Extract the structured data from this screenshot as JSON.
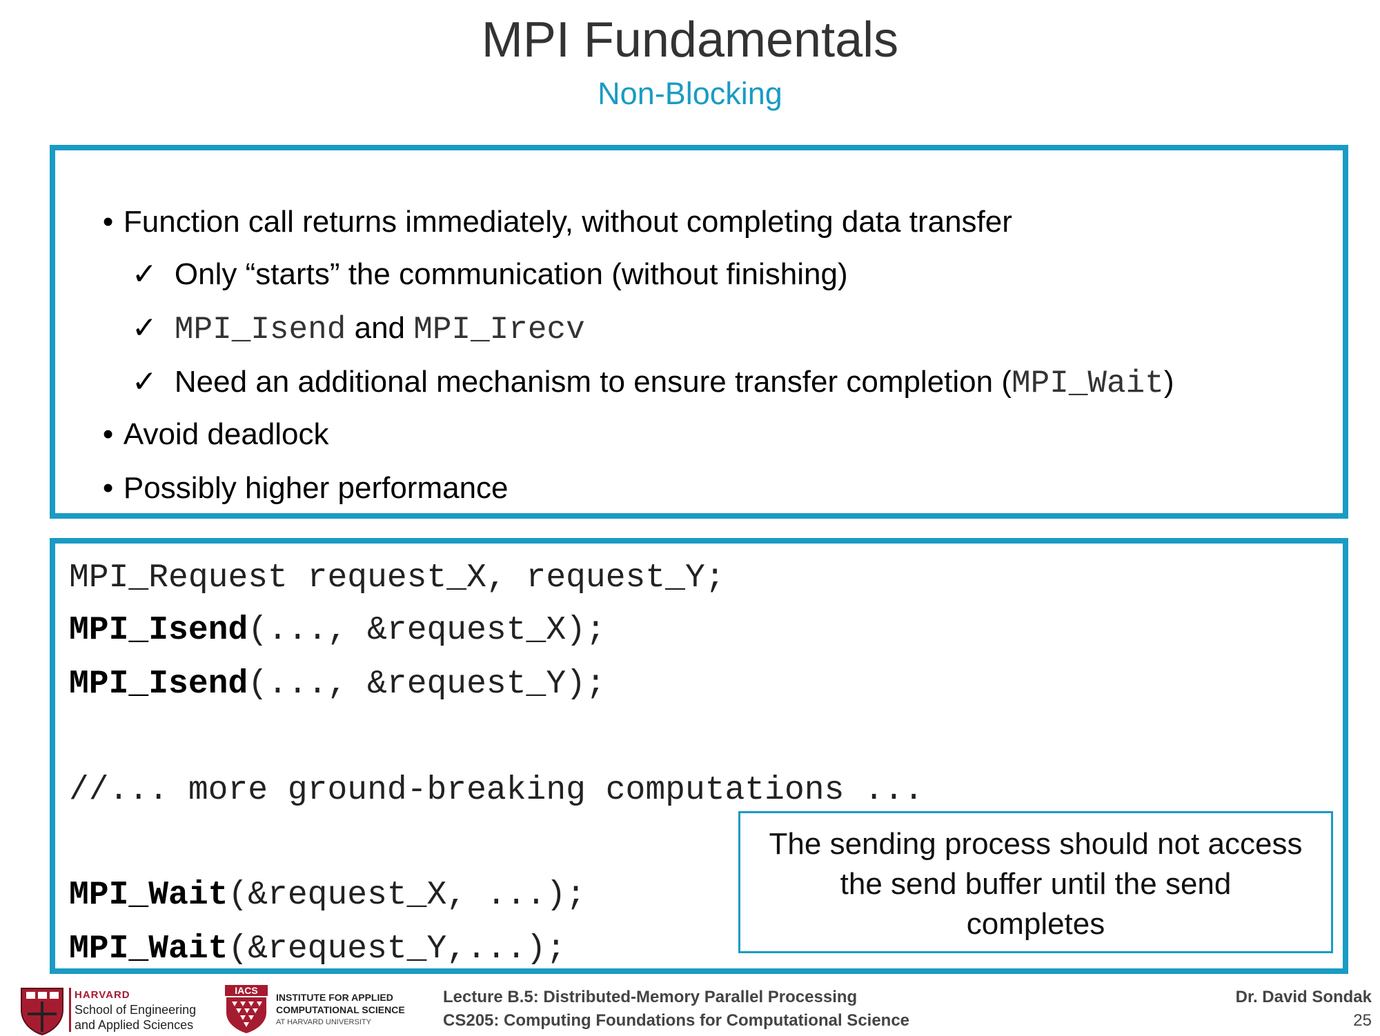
{
  "title": "MPI Fundamentals",
  "subtitle": "Non-Blocking",
  "bullets": {
    "b1": "Function call returns immediately, without completing data transfer",
    "c1": "Only “starts” the communication (without finishing)",
    "c2_code1": "MPI_Isend",
    "c2_and": "and",
    "c2_code2": "MPI_Irecv",
    "c3_text": "Need an additional mechanism to ensure transfer completion (",
    "c3_code": "MPI_Wait",
    "c3_end": ")",
    "b2": "Avoid deadlock",
    "b3": "Possibly higher performance",
    "bullet_glyph": "•",
    "check_glyph": "✓"
  },
  "code": {
    "l1": "MPI_Request request_X, request_Y;",
    "l2_fn": "MPI_Isend",
    "l2_args": "(..., &request_X);",
    "l3_fn": "MPI_Isend",
    "l3_args": "(..., &request_Y);",
    "l4": "//... more ground-breaking computations ...",
    "l5_fn": "MPI_Wait",
    "l5_args": "(&request_X, ...);",
    "l6_fn": "MPI_Wait",
    "l6_args": "(&request_Y,...);"
  },
  "callout": {
    "line1": "The sending process should not access",
    "line2": "the send buffer until the send",
    "line3": "completes"
  },
  "footer": {
    "harvard": "HARVARD",
    "seas1": "School of Engineering",
    "seas2": "and Applied Sciences",
    "iacs_badge": "IACS",
    "iacs1": "INSTITUTE FOR APPLIED",
    "iacs2": "COMPUTATIONAL SCIENCE",
    "iacs3": "AT HARVARD UNIVERSITY",
    "lecture": "Lecture B.5: Distributed-Memory Parallel Processing",
    "course": "CS205: Computing Foundations for Computational Science",
    "author": "Dr. David Sondak",
    "page": "25"
  },
  "colors": {
    "accent": "#1a9bc4",
    "harvard_red": "#a51c30",
    "title_gray": "#333333"
  }
}
